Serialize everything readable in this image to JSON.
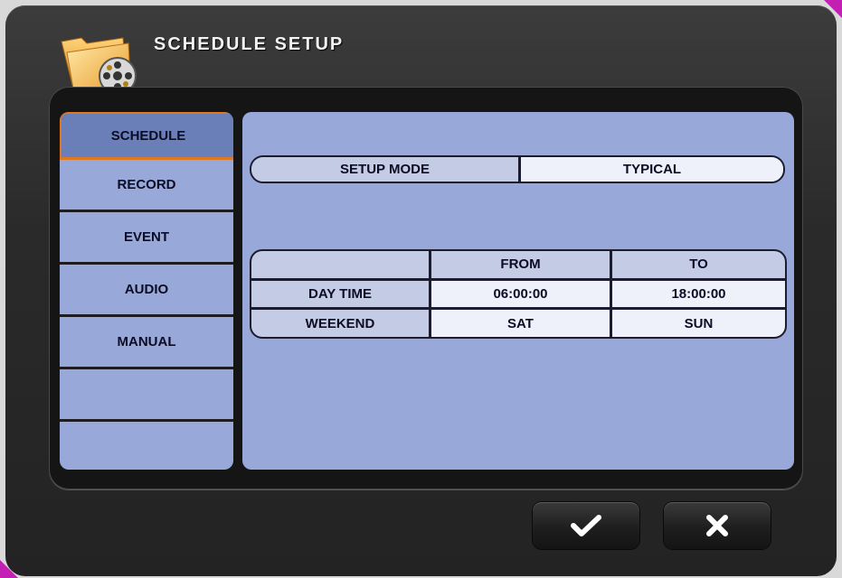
{
  "window": {
    "title": "SCHEDULE SETUP",
    "icon": "folder-film-reel-icon"
  },
  "sidebar": {
    "items": [
      {
        "label": "SCHEDULE",
        "active": true
      },
      {
        "label": "RECORD",
        "active": false
      },
      {
        "label": "EVENT",
        "active": false
      },
      {
        "label": "AUDIO",
        "active": false
      },
      {
        "label": "MANUAL",
        "active": false
      },
      {
        "label": "",
        "active": false
      },
      {
        "label": "",
        "active": false
      }
    ]
  },
  "setup_mode": {
    "label": "SETUP MODE",
    "value": "TYPICAL"
  },
  "schedule_table": {
    "headers": [
      "",
      "FROM",
      "TO"
    ],
    "rows": [
      {
        "label": "DAY TIME",
        "from": "06:00:00",
        "to": "18:00:00"
      },
      {
        "label": "WEEKEND",
        "from": "SAT",
        "to": "SUN"
      }
    ]
  },
  "buttons": {
    "ok_icon": "checkmark-icon",
    "cancel_icon": "close-icon"
  },
  "colors": {
    "panel": "#98a8d8",
    "active_tab": "#6a7eb8",
    "active_border": "#e07820",
    "cell_label": "#c4cbe4",
    "cell_value": "#eef0fa"
  }
}
